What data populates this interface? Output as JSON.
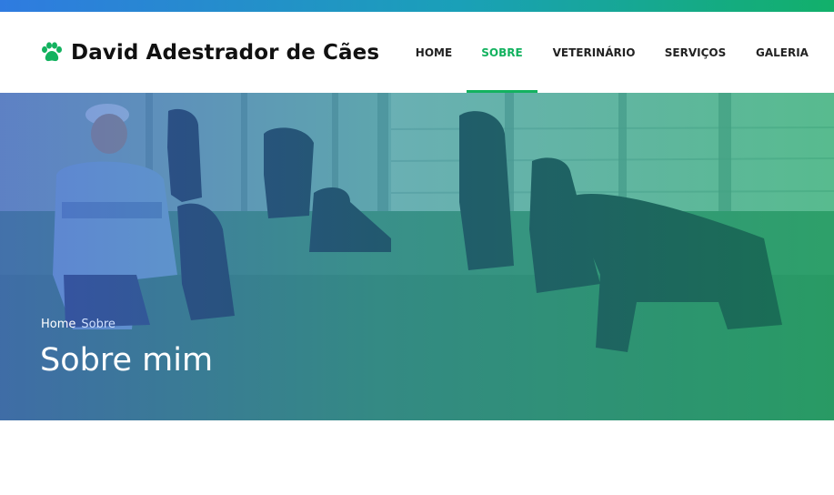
{
  "brand": {
    "name": "David Adestrador de Cães",
    "icon": "paw-icon",
    "color": "#13b25f"
  },
  "nav": {
    "items": [
      {
        "label": "HOME",
        "active": false
      },
      {
        "label": "SOBRE",
        "active": true
      },
      {
        "label": "VETERINÁRIO",
        "active": false
      },
      {
        "label": "SERVIÇOS",
        "active": false
      },
      {
        "label": "GALERIA",
        "active": false
      }
    ],
    "active_color": "#13b25f"
  },
  "hero": {
    "breadcrumb": {
      "home": "Home",
      "current": "Sobre"
    },
    "title": "Sobre mim",
    "image": "man-kneeling-with-rottweilers-photo"
  },
  "colors": {
    "topbar_start": "#2f7be0",
    "topbar_end": "#12b06a"
  }
}
